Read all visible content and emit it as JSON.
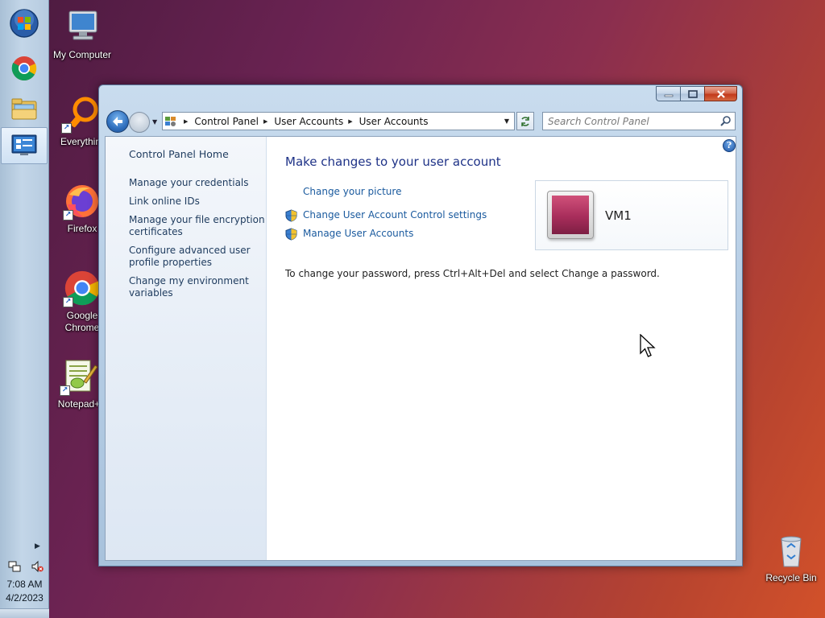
{
  "taskbar": {
    "pinned": [
      {
        "name": "start-orb-icon"
      },
      {
        "name": "chrome-icon"
      },
      {
        "name": "file-explorer-icon"
      },
      {
        "name": "control-panel-icon",
        "active": true
      }
    ],
    "clock": {
      "time": "7:08 AM",
      "date": "4/2/2023"
    }
  },
  "desktop": {
    "icons": [
      {
        "label": "My Computer",
        "icon": "computer-icon"
      },
      {
        "label": "Everythin",
        "icon": "everything-search-icon"
      },
      {
        "label": "Firefox",
        "icon": "firefox-icon"
      },
      {
        "label": "Google",
        "label2": "Chrome",
        "icon": "chrome-icon"
      },
      {
        "label": "Notepad+",
        "icon": "notepad-plus-icon"
      },
      {
        "label": "Recycle Bin",
        "icon": "recycle-bin-icon"
      }
    ]
  },
  "window": {
    "address": {
      "crumbs": [
        "Control Panel",
        "User Accounts",
        "User Accounts"
      ]
    },
    "search": {
      "placeholder": "Search Control Panel"
    },
    "sidebar": {
      "home": "Control Panel Home",
      "links": [
        {
          "line1": "Manage your credentials"
        },
        {
          "line1": "Link online IDs"
        },
        {
          "line1": "Manage your file encryption",
          "line2": "certificates"
        },
        {
          "line1": "Configure advanced user",
          "line2": "profile properties"
        },
        {
          "line1": "Change my environment",
          "line2": "variables"
        }
      ]
    },
    "main": {
      "title": "Make changes to your user account",
      "tasks": [
        {
          "label": "Change your picture",
          "shield": false
        },
        {
          "label": "Change User Account Control settings",
          "shield": true
        },
        {
          "label": "Manage User Accounts",
          "shield": true
        }
      ],
      "user": {
        "name": "VM1"
      },
      "password_note": "To change your password, press Ctrl+Alt+Del and select Change a password."
    }
  },
  "colors": {
    "link": "#1a5a9e",
    "title": "#1e3287",
    "sidebar_text": "#1e3b5e"
  }
}
